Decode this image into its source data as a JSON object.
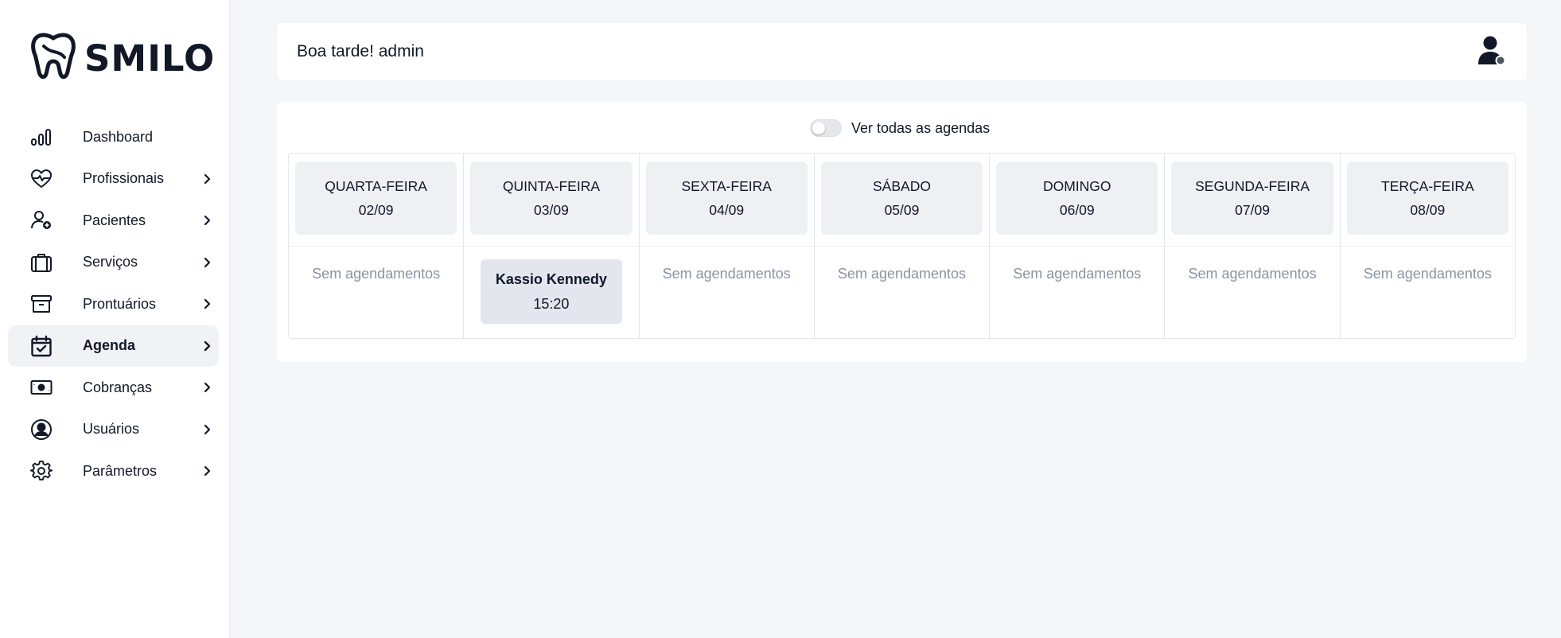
{
  "brand": {
    "name": "SMILO"
  },
  "header": {
    "greeting": "Boa tarde! admin"
  },
  "sidebar": {
    "items": [
      {
        "label": "Dashboard",
        "icon": "bar-chart-icon",
        "has_chevron": false,
        "active": false
      },
      {
        "label": "Profissionais",
        "icon": "heart-pulse-icon",
        "has_chevron": true,
        "active": false
      },
      {
        "label": "Pacientes",
        "icon": "user-add-icon",
        "has_chevron": true,
        "active": false
      },
      {
        "label": "Serviços",
        "icon": "briefcase-icon",
        "has_chevron": true,
        "active": false
      },
      {
        "label": "Prontuários",
        "icon": "archive-icon",
        "has_chevron": true,
        "active": false
      },
      {
        "label": "Agenda",
        "icon": "calendar-check-icon",
        "has_chevron": true,
        "active": true
      },
      {
        "label": "Cobranças",
        "icon": "cash-icon",
        "has_chevron": true,
        "active": false
      },
      {
        "label": "Usuários",
        "icon": "user-circle-icon",
        "has_chevron": true,
        "active": false
      },
      {
        "label": "Parâmetros",
        "icon": "gear-icon",
        "has_chevron": true,
        "active": false
      }
    ]
  },
  "agenda": {
    "toggle_label": "Ver todas as agendas",
    "toggle_on": false,
    "empty_text": "Sem agendamentos",
    "days": [
      {
        "name": "QUARTA-FEIRA",
        "date": "02/09",
        "appointments": []
      },
      {
        "name": "QUINTA-FEIRA",
        "date": "03/09",
        "appointments": [
          {
            "patient": "Kassio Kennedy",
            "time": "15:20"
          }
        ]
      },
      {
        "name": "SEXTA-FEIRA",
        "date": "04/09",
        "appointments": []
      },
      {
        "name": "SÁBADO",
        "date": "05/09",
        "appointments": []
      },
      {
        "name": "DOMINGO",
        "date": "06/09",
        "appointments": []
      },
      {
        "name": "SEGUNDA-FEIRA",
        "date": "07/09",
        "appointments": []
      },
      {
        "name": "TERÇA-FEIRA",
        "date": "08/09",
        "appointments": []
      }
    ]
  },
  "colors": {
    "background": "#f5f6fa",
    "card": "#ffffff",
    "day_header": "#eef0f4",
    "appointment": "#e3e6ec",
    "muted_text": "#8b93a1",
    "text": "#111827"
  }
}
